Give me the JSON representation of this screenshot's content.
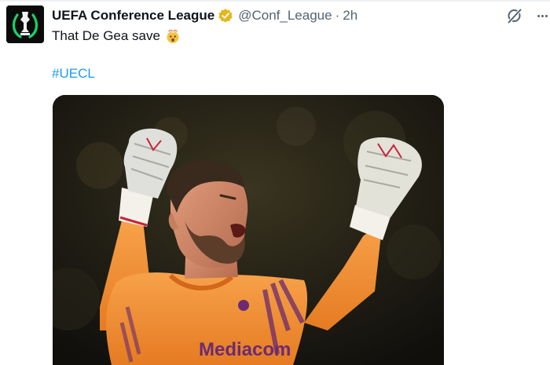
{
  "tweet": {
    "author": {
      "display_name": "UEFA Conference League",
      "handle": "@Conf_League",
      "verified": true,
      "avatar_icon": "uecl-trophy-logo"
    },
    "separator": "·",
    "time": "2h",
    "text": "That De Gea save",
    "emoji": "exploding-head-emoji",
    "hashtag": "#UECL",
    "media": {
      "kind": "photo",
      "jersey_sponsor": "Mediacom"
    },
    "actions": {
      "grok_icon": "grok-icon",
      "more_icon": "more-icon"
    }
  },
  "colors": {
    "text": "#0f1419",
    "secondary": "#536471",
    "link": "#1d9bf0",
    "verified_gold": "#e2b719"
  }
}
